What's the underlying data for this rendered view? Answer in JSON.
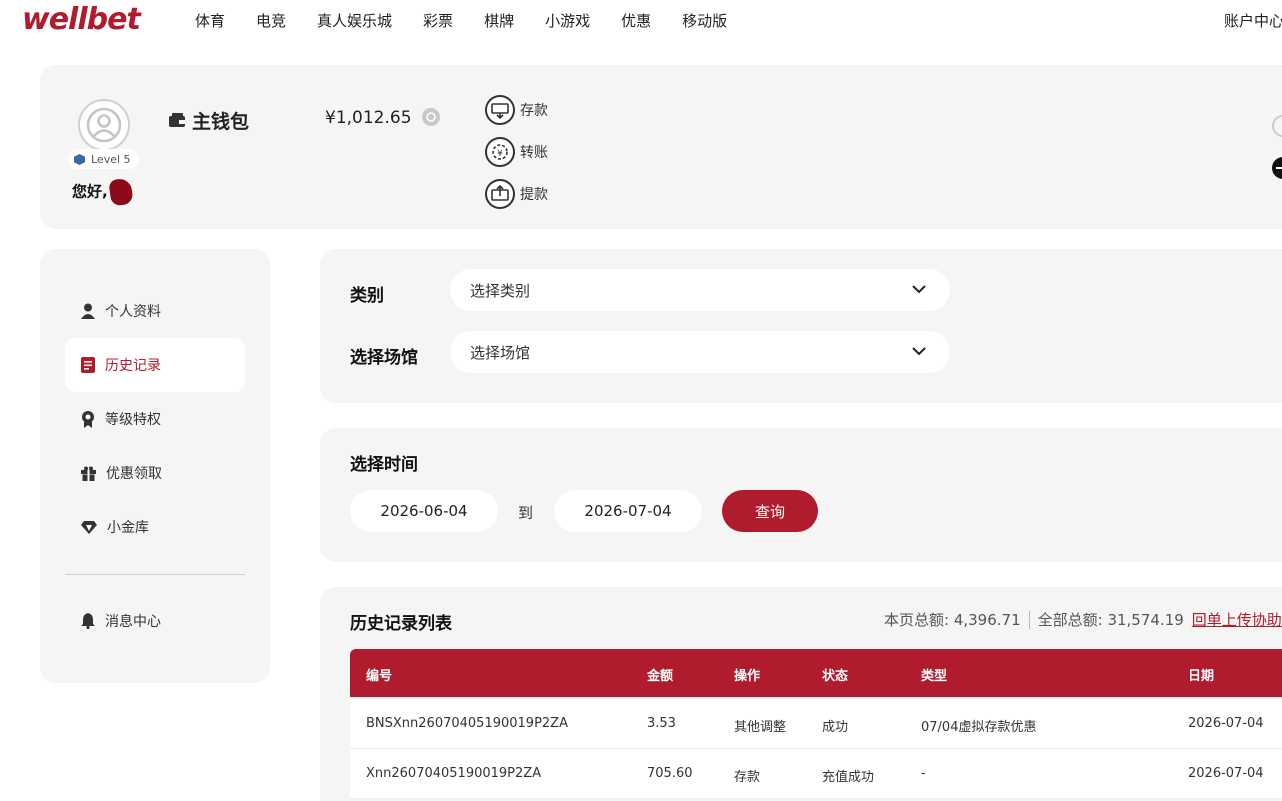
{
  "brand": {
    "logo_text": "wellbet",
    "accent": "#b01c2e"
  },
  "nav": {
    "items": [
      "体育",
      "电竞",
      "真人娱乐城",
      "彩票",
      "棋牌",
      "小游戏",
      "优惠",
      "移动版"
    ],
    "account": "账户中心"
  },
  "profile": {
    "level": "Level 5",
    "greeting": "您好,",
    "wallet_label": "主钱包",
    "balance": "¥1,012.65",
    "actions": [
      "存款",
      "转账",
      "提款"
    ]
  },
  "sidebar": {
    "items": [
      {
        "label": "个人资料",
        "icon": "user-icon"
      },
      {
        "label": "历史记录",
        "icon": "history-icon",
        "active": true
      },
      {
        "label": "等级特权",
        "icon": "medal-icon"
      },
      {
        "label": "优惠领取",
        "icon": "gift-icon"
      },
      {
        "label": "小金库",
        "icon": "diamond-icon"
      },
      {
        "label": "消息中心",
        "icon": "bell-icon"
      }
    ]
  },
  "filters": {
    "category_label": "类别",
    "category_placeholder": "选择类别",
    "venue_label": "选择场馆",
    "venue_placeholder": "选择场馆",
    "time_label": "选择时间",
    "date_from": "2026-06-04",
    "to_label": "到",
    "date_to": "2026-07-04",
    "query_button": "查询"
  },
  "history": {
    "title": "历史记录列表",
    "page_total": "本页总额: 4,396.71",
    "all_total": "全部总额: 31,574.19",
    "upload_link": "回单上传协助",
    "columns": [
      "编号",
      "金额",
      "操作",
      "状态",
      "类型",
      "日期"
    ],
    "rows": [
      [
        "BNSXnn26070405190019P2ZA",
        "3.53",
        "其他调整",
        "成功",
        "07/04虚拟存款优惠",
        "2026-07-04"
      ],
      [
        "Xnn26070405190019P2ZA",
        "705.60",
        "存款",
        "充值成功",
        "-",
        "2026-07-04"
      ]
    ]
  }
}
